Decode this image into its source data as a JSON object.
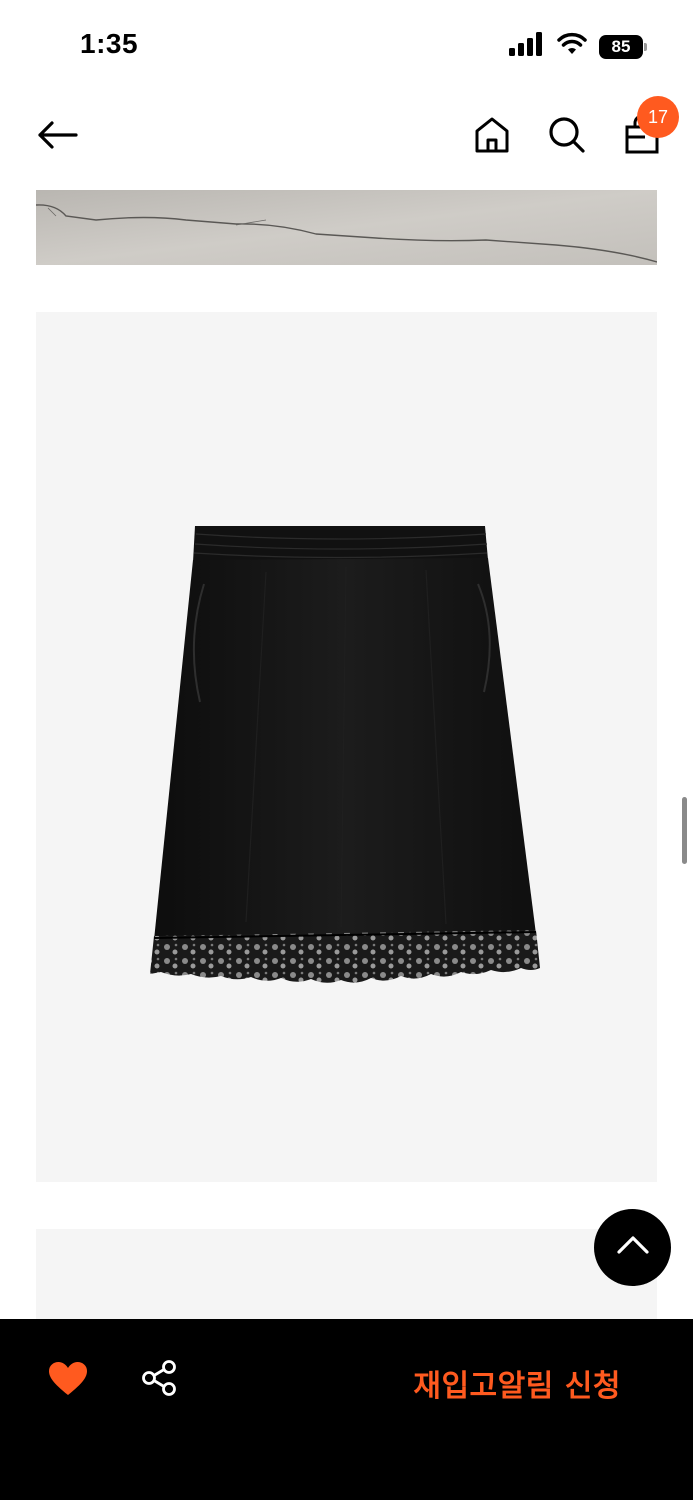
{
  "status_bar": {
    "time": "1:35",
    "battery": "85",
    "icons": [
      "signal-icon",
      "wifi-icon",
      "battery-icon"
    ]
  },
  "nav": {
    "icons": [
      "back-arrow-icon",
      "home-icon",
      "search-icon",
      "shopping-bag-icon",
      "scroll-to-top-icon",
      "heart-icon",
      "share-icon"
    ],
    "cart_count": "17"
  },
  "product": {
    "image_subject": "black slip skirt with lace hem"
  },
  "bottom_bar": {
    "restock_label": "재입고알림 신청"
  },
  "colors": {
    "accent": "#ff5a1f",
    "bar_background": "#000000",
    "image_background": "#f5f5f5"
  }
}
